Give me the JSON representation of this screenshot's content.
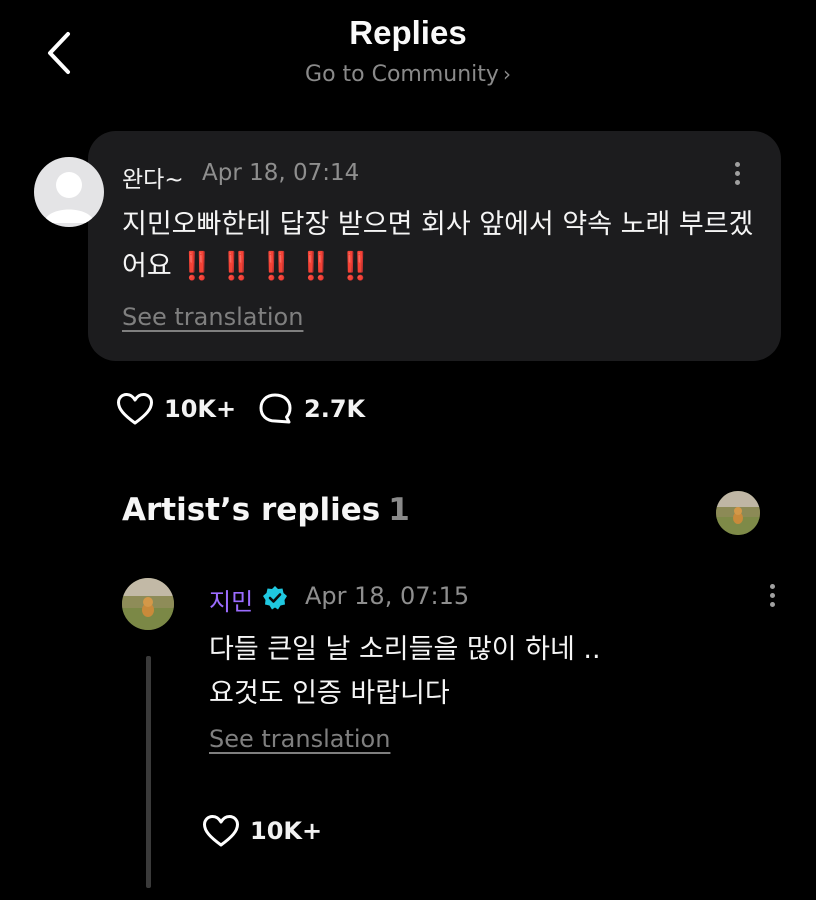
{
  "header": {
    "title": "Replies",
    "community_link": "Go to Community",
    "back_icon": "chevron-left-icon"
  },
  "comment": {
    "author": "완다~",
    "timestamp": "Apr 18, 07:14",
    "text": "지민오빠한테 답장 받으면 회사 앞에서 약속 노래 부르겠어요",
    "emphasis": "‼️‼️‼️‼️‼️",
    "see_translation": "See translation",
    "likes": "10K+",
    "replies": "2.7K"
  },
  "artist_section": {
    "title": "Artist’s replies",
    "count": "1"
  },
  "artist_reply": {
    "author": "지민",
    "timestamp": "Apr 18, 07:15",
    "line1": "다들 큰일 날 소리들을 많이 하네 ..",
    "line2": "요것도 인증 바랍니다",
    "see_translation": "See translation",
    "likes": "10K+"
  },
  "colors": {
    "background": "#000000",
    "card": "#1c1c1e",
    "artist_name": "#9b6cff",
    "verified_badge": "#1fc8e0",
    "emphasis": "#ff2a2a",
    "muted_text": "#8e8e8e"
  }
}
